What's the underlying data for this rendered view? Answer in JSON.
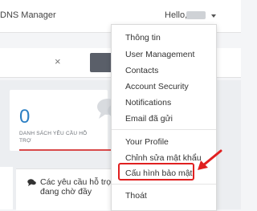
{
  "header": {
    "app_title": "DNS Manager",
    "greeting": "Hello,"
  },
  "search": {
    "clear_symbol": "×"
  },
  "stat_card": {
    "value": "0",
    "label": "DANH SÁCH YÊU CẦU HỖ TRỢ"
  },
  "ticket_panel": {
    "title": "Các yêu cầu hỗ trợ đang chờ đầy"
  },
  "user_menu": {
    "items": [
      {
        "label": "Thông tin"
      },
      {
        "label": "User Management"
      },
      {
        "label": "Contacts"
      },
      {
        "label": "Account Security"
      },
      {
        "label": "Notifications"
      },
      {
        "label": "Email đã gửi"
      },
      {
        "label": "Your Profile"
      },
      {
        "label": "Chỉnh sửa mật khẩu"
      },
      {
        "label": "Cấu hình bảo mật"
      },
      {
        "label": "Thoát"
      }
    ]
  },
  "colors": {
    "accent_blue": "#2b7fc3",
    "highlight_red": "#e02020",
    "underline_red": "#d94a4a"
  }
}
